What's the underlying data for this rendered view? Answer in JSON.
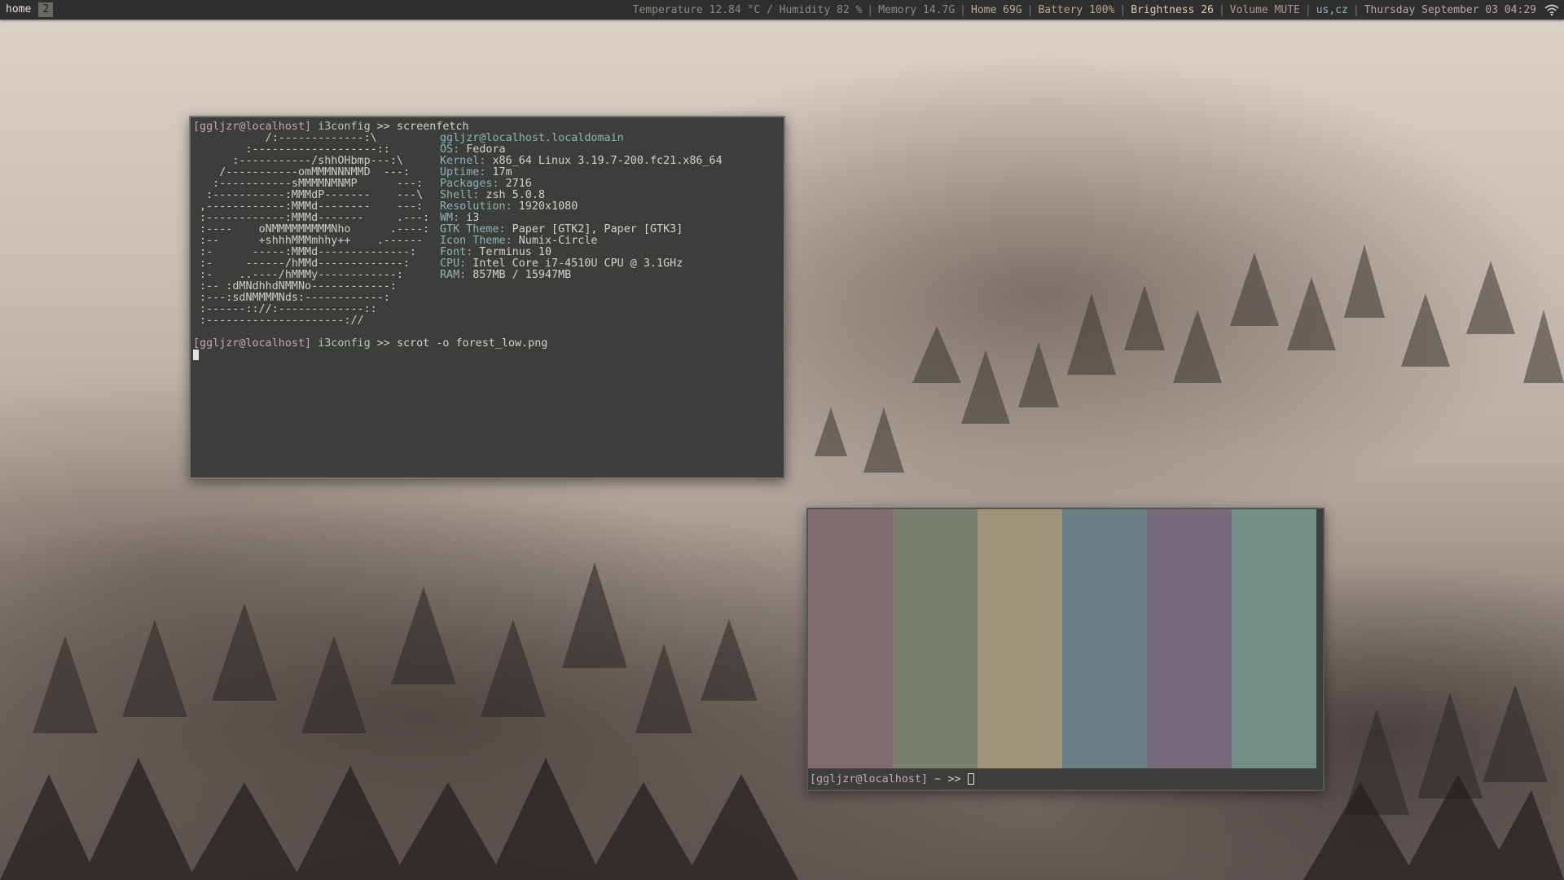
{
  "bar": {
    "workspaces": [
      {
        "label": "home",
        "active": true
      },
      {
        "label": "2",
        "active": false
      }
    ],
    "status": {
      "temperature": "Temperature 12.84 °C",
      "humidity": "Humidity 82 %",
      "memory": "Memory 14.7G",
      "home": "Home 69G",
      "battery": "Battery 100%",
      "brightness": "Brightness 26",
      "volume": "Volume MUTE",
      "layout": "us,cz",
      "datetime": "Thursday September 03 04:29",
      "slash": "/",
      "sep": "|"
    },
    "wifi_icon": "wifi-icon"
  },
  "term1": {
    "prompt1": {
      "user": "[ggljzr@localhost]",
      "dir": "i3config",
      "arrow": ">>",
      "cmd": "screenfetch"
    },
    "userhost": {
      "user": "ggljzr",
      "host": "@localhost.localdomain"
    },
    "logo": [
      "           /:-------------:\\",
      "        :-------------------::",
      "      :-----------/shhOHbmp---:\\",
      "    /-----------omMMMNNNMMD  ---:",
      "   :-----------sMMMMNMNMP      ---:",
      "  :-----------:MMMdP-------    ---\\",
      " ,------------:MMMd--------    ---:",
      " :------------:MMMd-------     .---:",
      " :----    oNMMMMMMMMMNho      .----:",
      " :--      +shhhMMMmhhy++    .------",
      " :-      -----:MMMd--------------:",
      " :-     ------/hMMd-------------:",
      " :-    ..----/hMMMy------------:",
      " :-- :dMNdhhdNMMNo------------:",
      " :---:sdNMMMMNds:------------:",
      " :------:://:-------------::",
      " :---------------------://"
    ],
    "info": [
      {
        "key": "OS:",
        "val": "Fedora"
      },
      {
        "key": "Kernel:",
        "val": "x86_64 Linux 3.19.7-200.fc21.x86_64"
      },
      {
        "key": "Uptime:",
        "val": "17m"
      },
      {
        "key": "Packages:",
        "val": "2716"
      },
      {
        "key": "Shell:",
        "val": "zsh 5.0.8"
      },
      {
        "key": "Resolution:",
        "val": "1920x1080"
      },
      {
        "key": "WM:",
        "val": "i3"
      },
      {
        "key": "GTK Theme:",
        "val": "Paper [GTK2], Paper [GTK3]"
      },
      {
        "key": "Icon Theme:",
        "val": "Numix-Circle"
      },
      {
        "key": "Font:",
        "val": "Terminus 10"
      },
      {
        "key": "CPU:",
        "val": "Intel Core i7-4510U CPU @ 3.1GHz"
      },
      {
        "key": "RAM:",
        "val": "857MB / 15947MB"
      }
    ],
    "prompt2": {
      "user": "[ggljzr@localhost]",
      "dir": "i3config",
      "arrow": ">>",
      "cmd": "scrot -o forest_low.png"
    }
  },
  "term2": {
    "swatches": [
      "#826b6c",
      "#7a8070",
      "#a09479",
      "#6a7f85",
      "#786a7d",
      "#728e86"
    ],
    "prompt": {
      "user": "[ggljzr@localhost]",
      "dir": "~",
      "arrow": ">>"
    }
  }
}
